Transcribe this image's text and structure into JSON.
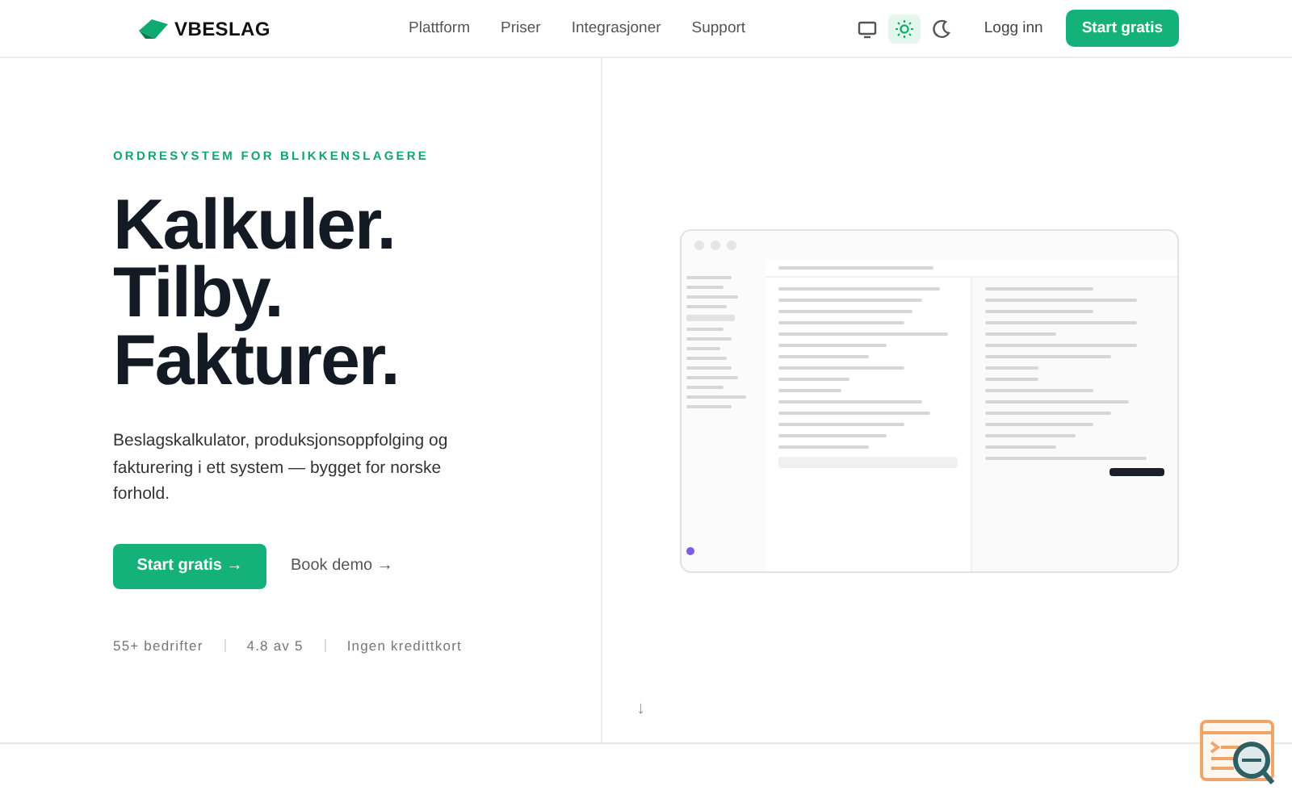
{
  "header": {
    "logo": "VBESLAG",
    "nav": [
      "Plattform",
      "Priser",
      "Integrasjoner",
      "Support"
    ],
    "theme_options": [
      {
        "kind": "monitor",
        "selected": false
      },
      {
        "kind": "sun",
        "selected": true
      },
      {
        "kind": "moon",
        "selected": false
      }
    ],
    "login": "Logg inn",
    "cta": "Start gratis"
  },
  "hero": {
    "eyebrow": "ORDRESYSTEM FOR BLIKKENSLAGERE",
    "headline": [
      "Kalkuler.",
      "Tilby.",
      "Fakturer."
    ],
    "description": "Beslagskalkulator, produksjonsoppfolging og fakturering i ett system — bygget for norske forhold.",
    "primary_button": "Start gratis →",
    "secondary_link": "Book demo →",
    "stats": [
      "55+ bedrifter",
      "4.8 av 5",
      "Ingen kredittkort"
    ]
  },
  "scroll_hint": "↓"
}
